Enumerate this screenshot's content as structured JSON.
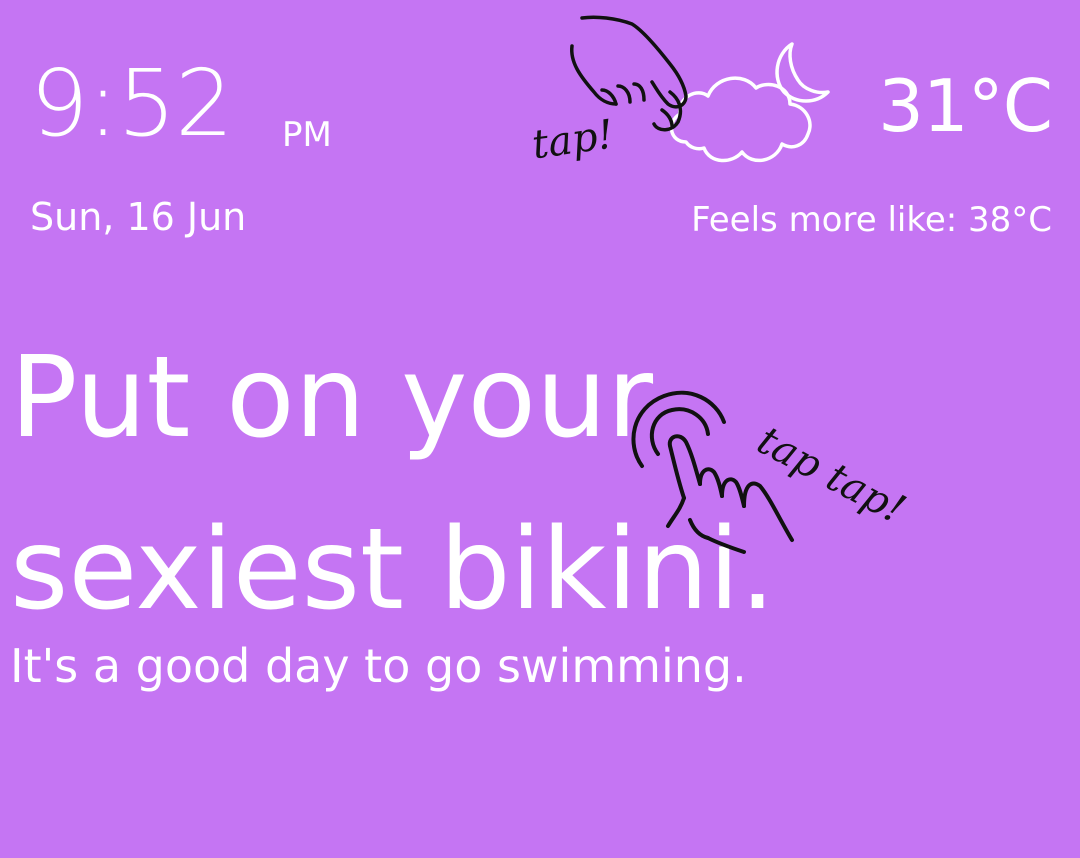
{
  "theme": {
    "background": "#c575f3",
    "foreground": "#ffffff",
    "doodle": "#111111"
  },
  "clock": {
    "time": "9:52",
    "ampm": "PM",
    "date": "Sun, 16 Jun"
  },
  "weather": {
    "icon": "cloud-moon-icon",
    "temperature": "31°C",
    "feels_like": "Feels more like: 38°C"
  },
  "message": {
    "headline": "Put on your sexiest bikini.",
    "subheadline": "It's a good day to go swimming."
  },
  "hints": {
    "weather_tap": "tap!",
    "headline_tap": "tap tap!"
  }
}
